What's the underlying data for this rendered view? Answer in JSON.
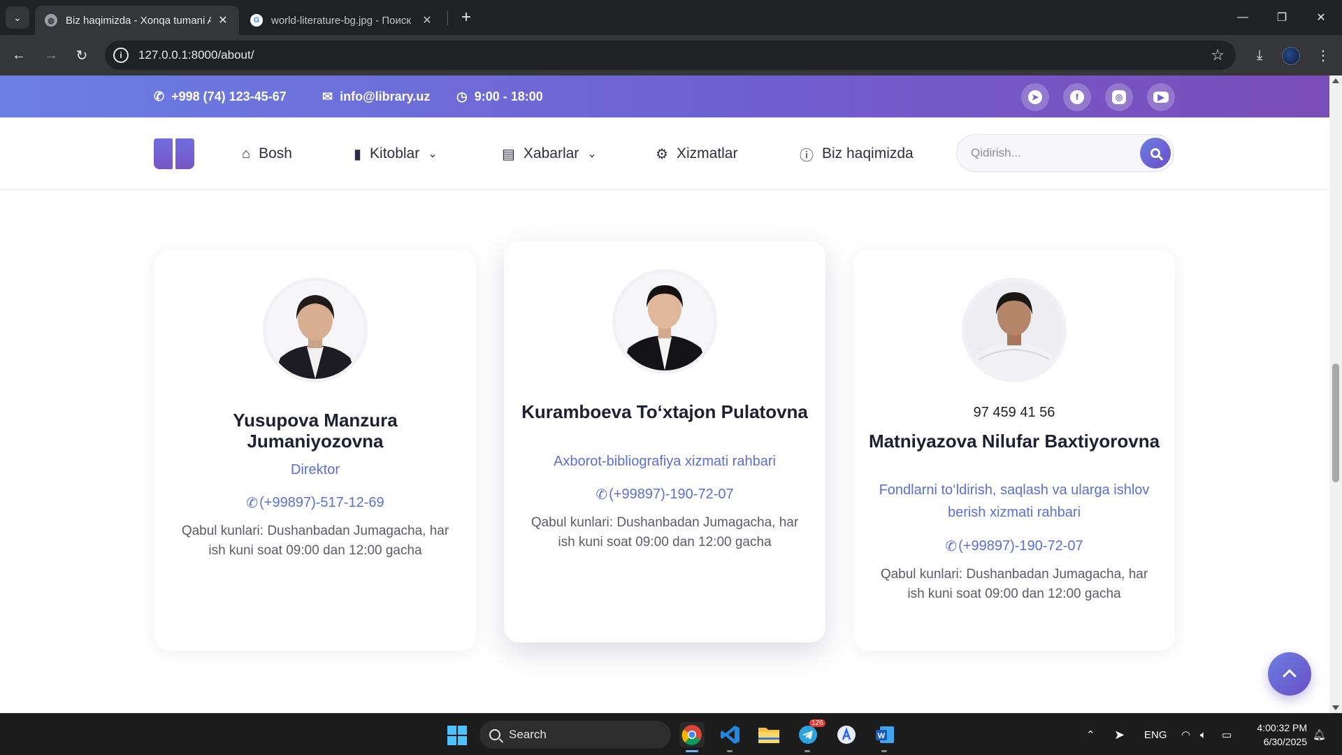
{
  "browser": {
    "tabs": [
      {
        "title": "Biz haqimizda - Xonqa tumani A",
        "active": true
      },
      {
        "title": "world-literature-bg.jpg - Поиск",
        "active": false
      }
    ],
    "url": "127.0.0.1:8000/about/"
  },
  "topbar": {
    "phone": "+998 (74) 123-45-67",
    "email": "info@library.uz",
    "hours": "9:00 - 18:00",
    "socials": [
      "telegram-icon",
      "facebook-icon",
      "instagram-icon",
      "youtube-icon"
    ]
  },
  "nav": {
    "items": [
      {
        "label": "Bosh",
        "icon": "home-icon"
      },
      {
        "label": "Kitoblar",
        "icon": "book-icon",
        "dropdown": true
      },
      {
        "label": "Xabarlar",
        "icon": "newspaper-icon",
        "dropdown": true
      },
      {
        "label": "Xizmatlar",
        "icon": "gears-icon"
      },
      {
        "label": "Biz haqimizda",
        "icon": "info-icon"
      }
    ],
    "search_placeholder": "Qidirish..."
  },
  "staff": [
    {
      "name": "Yusupova Manzura Jumaniyozovna",
      "role": "Direktor",
      "phone": "(+99897)-517-12-69",
      "hours": "Qabul kunlari: Dushanbadan Jumagacha, har ish kuni soat 09:00 dan 12:00 gacha"
    },
    {
      "name": "Kuramboeva To‘xtajon Pulatovna",
      "role": "Axborot-bibliografiya xizmati rahbari",
      "phone": "(+99897)-190-72-07",
      "hours": "Qabul kunlari: Dushanbadan Jumagacha, har ish kuni soat 09:00 dan 12:00 gacha"
    },
    {
      "extra": "97 459 41 56",
      "name": "Matniyazova Nilufar Baxtiyorovna",
      "role": "Fondlarni to‘ldirish, saqlash va ularga ishlov berish xizmati rahbari",
      "phone": "(+99897)-190-72-07",
      "hours": "Qabul kunlari: Dushanbadan Jumagacha, har ish kuni soat 09:00 dan 12:00 gacha"
    }
  ],
  "taskbar": {
    "search_label": "Search",
    "telegram_badge": "126",
    "language": "ENG",
    "time": "4:00:32 PM",
    "date": "6/30/2025"
  },
  "colors": {
    "accent": "#6b7fe3",
    "accent_dark": "#6a4fc6",
    "link": "#5b6fd8"
  }
}
